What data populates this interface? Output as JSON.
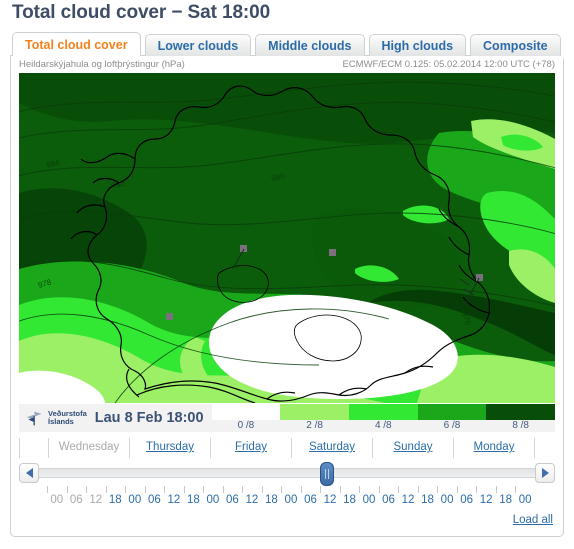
{
  "page_title": "Total cloud cover − Sat 18:00",
  "tabs": [
    {
      "label": "Total cloud cover",
      "active": true
    },
    {
      "label": "Lower clouds",
      "active": false
    },
    {
      "label": "Middle clouds",
      "active": false
    },
    {
      "label": "High clouds",
      "active": false
    },
    {
      "label": "Composite",
      "active": false
    }
  ],
  "caption": {
    "left": "Heildarskýjahula og loftþrýstingur (hPa)",
    "right": "ECMWF/ECM 0.125: 05.02.2014 12:00 UTC (+78)"
  },
  "map": {
    "contour_labels": [
      "984",
      "982",
      "980",
      "978",
      "976",
      "978"
    ],
    "background_color": "#0b5c0b"
  },
  "legend": {
    "logo_line1": "Veðurstofa",
    "logo_line2": "Íslands",
    "date_label": "Lau 8 Feb 18:00",
    "ticks": [
      "0 /8",
      "2 /8",
      "4 /8",
      "6 /8",
      "8 /8"
    ],
    "colors": [
      "#ffffff",
      "#9bf066",
      "#33e833",
      "#1aa81a",
      "#084d08"
    ]
  },
  "daynav": {
    "days": [
      {
        "label": "Wednesday",
        "disabled": true
      },
      {
        "label": "Thursday",
        "disabled": false
      },
      {
        "label": "Friday",
        "disabled": false
      },
      {
        "label": "Saturday",
        "disabled": false
      },
      {
        "label": "Sunday",
        "disabled": false
      },
      {
        "label": "Monday",
        "disabled": false
      }
    ],
    "prev_arrow": "◀",
    "next_arrow": "▶",
    "slider_position_percent": 58
  },
  "hours": [
    {
      "label": "00",
      "disabled": true
    },
    {
      "label": "06",
      "disabled": true
    },
    {
      "label": "12",
      "disabled": true
    },
    {
      "label": "18",
      "disabled": false
    },
    {
      "label": "00",
      "disabled": false
    },
    {
      "label": "06",
      "disabled": false
    },
    {
      "label": "12",
      "disabled": false
    },
    {
      "label": "18",
      "disabled": false
    },
    {
      "label": "00",
      "disabled": false
    },
    {
      "label": "06",
      "disabled": false
    },
    {
      "label": "12",
      "disabled": false
    },
    {
      "label": "18",
      "disabled": false
    },
    {
      "label": "00",
      "disabled": false
    },
    {
      "label": "06",
      "disabled": false
    },
    {
      "label": "12",
      "disabled": false
    },
    {
      "label": "18",
      "disabled": false
    },
    {
      "label": "00",
      "disabled": false
    },
    {
      "label": "06",
      "disabled": false
    },
    {
      "label": "12",
      "disabled": false
    },
    {
      "label": "18",
      "disabled": false
    },
    {
      "label": "00",
      "disabled": false
    },
    {
      "label": "06",
      "disabled": false
    },
    {
      "label": "12",
      "disabled": false
    },
    {
      "label": "18",
      "disabled": false
    },
    {
      "label": "00",
      "disabled": false
    }
  ],
  "load_all_label": "Load all"
}
